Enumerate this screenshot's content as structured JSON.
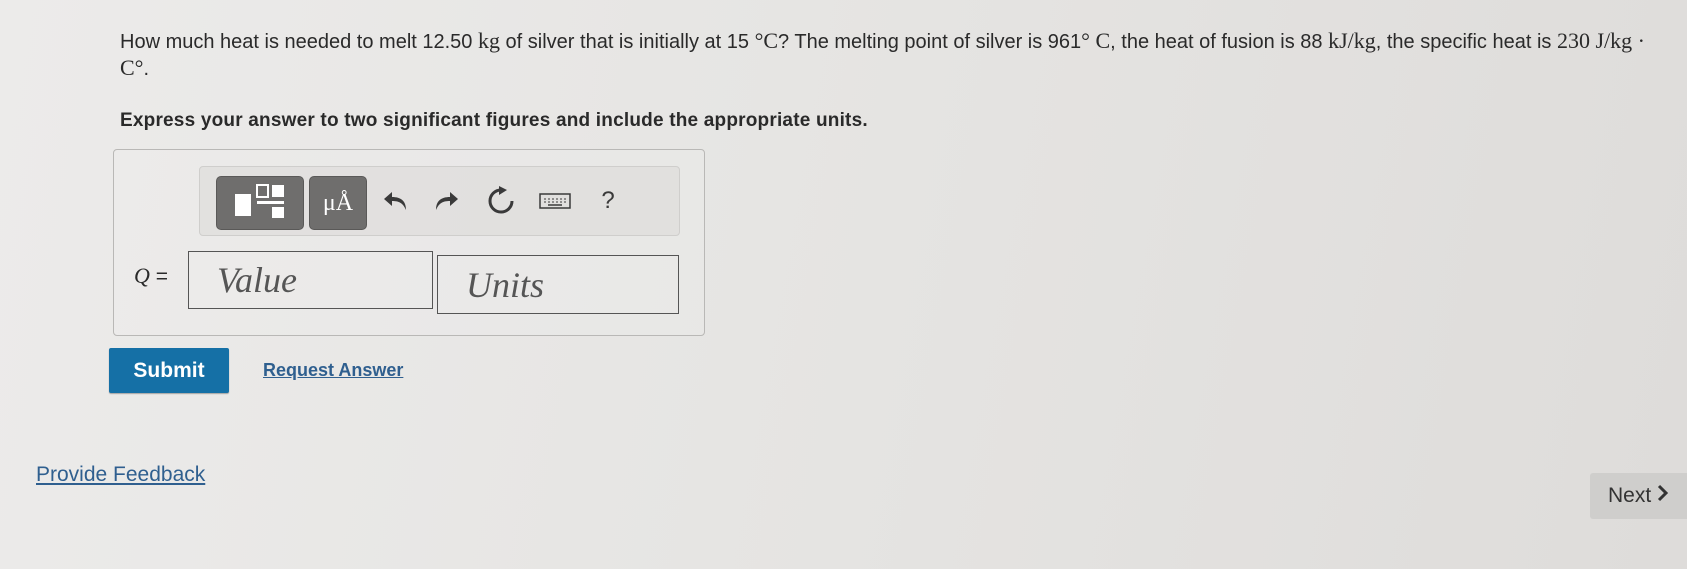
{
  "question": {
    "t1": "How much heat is needed to melt 12.50 ",
    "m1": "kg",
    "t2": " of silver that is initially at 15 ",
    "m2": "°C",
    "t3": "? The melting point of silver is 961",
    "m3": "° C",
    "t4": ", the heat of fusion is 88 ",
    "m4": "kJ/kg",
    "t5": ", the specific heat is ",
    "m5": "230 J/kg · C°",
    "t6": "."
  },
  "instruction": "Express your answer to two significant figures and include the appropriate units.",
  "toolbar": {
    "units_label": "μÅ",
    "help_label": "?",
    "icons": [
      "templates-icon",
      "units-icon",
      "undo-icon",
      "redo-icon",
      "reset-icon",
      "keyboard-icon",
      "help-icon"
    ]
  },
  "answer": {
    "variable": "Q",
    "equals": " =",
    "value_placeholder": "Value",
    "units_placeholder": "Units"
  },
  "actions": {
    "submit": "Submit",
    "request": "Request Answer"
  },
  "footer": {
    "feedback": "Provide Feedback",
    "next": "Next"
  },
  "colors": {
    "submit_bg": "#1570a6",
    "link": "#2f5f8f",
    "toolbar_button": "#6f6e6d"
  }
}
